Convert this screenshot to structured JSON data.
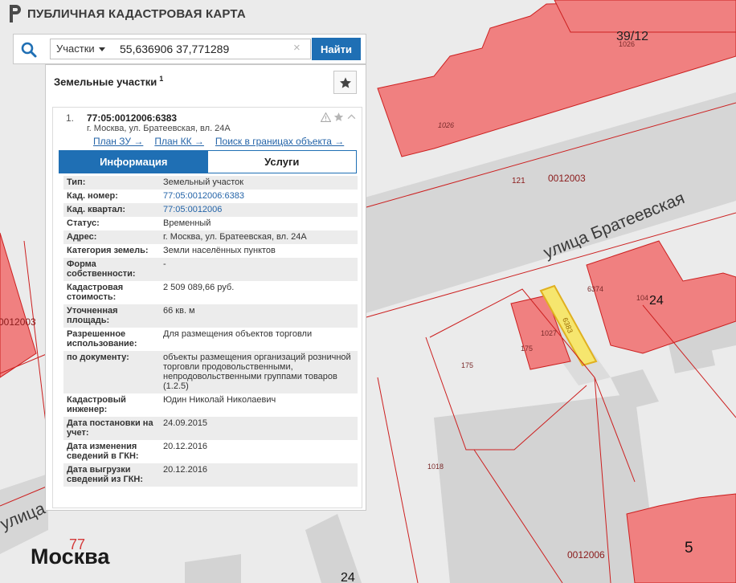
{
  "app": {
    "title": "ПУБЛИЧНАЯ КАДАСТРОВАЯ КАРТА"
  },
  "search": {
    "type_label": "Участки",
    "query": "55,636906 37,771289",
    "clear_glyph": "×",
    "find_label": "Найти"
  },
  "panel": {
    "title": "Земельные участки",
    "count": "1",
    "result": {
      "index": "1.",
      "cad_number": "77:05:0012006:6383",
      "address": "г. Москва, ул. Братеевская, вл. 24А",
      "links": [
        "План ЗУ →",
        "План КК →",
        "Поиск в границах объекта →"
      ],
      "tabs": {
        "info": "Информация",
        "services": "Услуги"
      },
      "rows": [
        {
          "key": "Тип:",
          "value": "Земельный участок"
        },
        {
          "key": "Кад. номер:",
          "value": "77:05:0012006:6383"
        },
        {
          "key": "Кад. квартал:",
          "value": "77:05:0012006"
        },
        {
          "key": "Статус:",
          "value": "Временный"
        },
        {
          "key": "Адрес:",
          "value": "г. Москва, ул. Братеевская, вл. 24А"
        },
        {
          "key": "Категория земель:",
          "value": "Земли населённых пунктов"
        },
        {
          "key": "Форма собственности:",
          "value": "-"
        },
        {
          "key": "Кадастровая стоимость:",
          "value": "2 509 089,66 руб."
        },
        {
          "key": "Уточненная площадь:",
          "value": "66 кв. м"
        },
        {
          "key": "Разрешенное использование:",
          "value": "Для размещения объектов торговли"
        },
        {
          "key": "по документу:",
          "value": "объекты размещения организаций розничной торговли продовольственными, непродовольственными группами товаров (1.2.5)"
        },
        {
          "key": "Кадастровый инженер:",
          "value": "Юдин Николай Николаевич"
        },
        {
          "key": "Дата постановки на учет:",
          "value": "24.09.2015"
        },
        {
          "key": "Дата изменения сведений в ГКН:",
          "value": "20.12.2016"
        },
        {
          "key": "Дата выгрузки сведений из ГКН:",
          "value": "20.12.2016"
        }
      ]
    }
  },
  "map": {
    "labels": {
      "house_39_12": "39/12",
      "n1026a": "1026",
      "n1026b": "1026",
      "n121": "121",
      "q0012003": "0012003",
      "street": "улица Братеевская",
      "n6374": "6374",
      "n104": "104",
      "house24": "24",
      "n1027": "1027",
      "n6383": "6383",
      "n175a": "175",
      "n175b": "175",
      "left0012003": "0012003",
      "n1018": "1018",
      "street_left": "улица",
      "region77": "77",
      "city": "Москва",
      "house24b": "24",
      "q0012006": "0012006",
      "house5": "5"
    },
    "colors": {
      "background": "#ebebeb",
      "building": "#d3d3d3",
      "parcel_fill": "#f08080",
      "parcel_stroke": "#cc1f1f",
      "highlight": "#f6e66e",
      "street": "#d6d6d6"
    }
  }
}
